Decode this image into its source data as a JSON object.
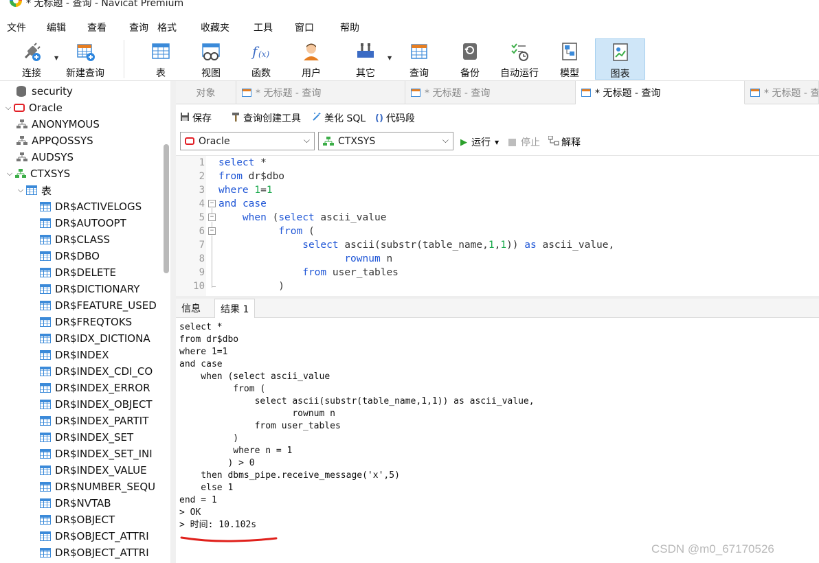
{
  "window": {
    "title": "* 无标题 - 查询 - Navicat Premium"
  },
  "menu": [
    "文件",
    "编辑",
    "查看",
    "查询",
    "格式",
    "收藏夹",
    "工具",
    "窗口",
    "帮助"
  ],
  "toolbar": {
    "connect": "连接",
    "new_query": "新建查询",
    "table": "表",
    "view": "视图",
    "function": "函数",
    "user": "用户",
    "other": "其它",
    "query": "查询",
    "backup": "备份",
    "automation": "自动运行",
    "model": "模型",
    "chart": "图表"
  },
  "sidebar": {
    "items": [
      {
        "label": "security",
        "type": "db"
      },
      {
        "label": "Oracle",
        "type": "oracle"
      },
      {
        "label": "ANONYMOUS",
        "type": "schema"
      },
      {
        "label": "APPQOSSYS",
        "type": "schema"
      },
      {
        "label": "AUDSYS",
        "type": "schema"
      },
      {
        "label": "CTXSYS",
        "type": "schema-active"
      },
      {
        "label": "表",
        "type": "tables"
      },
      {
        "label": "DR$ACTIVELOGS",
        "type": "table"
      },
      {
        "label": "DR$AUTOOPT",
        "type": "table"
      },
      {
        "label": "DR$CLASS",
        "type": "table"
      },
      {
        "label": "DR$DBO",
        "type": "table"
      },
      {
        "label": "DR$DELETE",
        "type": "table"
      },
      {
        "label": "DR$DICTIONARY",
        "type": "table"
      },
      {
        "label": "DR$FEATURE_USED",
        "type": "table"
      },
      {
        "label": "DR$FREQTOKS",
        "type": "table"
      },
      {
        "label": "DR$IDX_DICTIONA",
        "type": "table"
      },
      {
        "label": "DR$INDEX",
        "type": "table"
      },
      {
        "label": "DR$INDEX_CDI_CO",
        "type": "table"
      },
      {
        "label": "DR$INDEX_ERROR",
        "type": "table"
      },
      {
        "label": "DR$INDEX_OBJECT",
        "type": "table"
      },
      {
        "label": "DR$INDEX_PARTIT",
        "type": "table"
      },
      {
        "label": "DR$INDEX_SET",
        "type": "table"
      },
      {
        "label": "DR$INDEX_SET_INI",
        "type": "table"
      },
      {
        "label": "DR$INDEX_VALUE",
        "type": "table"
      },
      {
        "label": "DR$NUMBER_SEQU",
        "type": "table"
      },
      {
        "label": "DR$NVTAB",
        "type": "table"
      },
      {
        "label": "DR$OBJECT",
        "type": "table"
      },
      {
        "label": "DR$OBJECT_ATTRI",
        "type": "table"
      },
      {
        "label": "DR$OBJECT_ATTRI",
        "type": "table"
      }
    ]
  },
  "tabs": [
    {
      "label": "对象",
      "active": false
    },
    {
      "label": "* 无标题 - 查询",
      "active": false
    },
    {
      "label": "* 无标题 - 查询",
      "active": false
    },
    {
      "label": "* 无标题 - 查询",
      "active": true
    },
    {
      "label": "* 无标题 - 查询",
      "active": false
    }
  ],
  "query_toolbar": {
    "save": "保存",
    "builder": "查询创建工具",
    "beautify": "美化 SQL",
    "snippet": "代码段"
  },
  "connection_select": "Oracle",
  "schema_select": "CTXSYS",
  "run": {
    "run": "运行",
    "stop": "停止",
    "explain": "解释"
  },
  "editor": {
    "line_numbers": [
      "1",
      "2",
      "3",
      "4",
      "5",
      "6",
      "7",
      "8",
      "9",
      "10"
    ]
  },
  "result_tabs": [
    "信息",
    "结果 1"
  ],
  "output": [
    "select *",
    "from dr$dbo",
    "where 1=1",
    "and case",
    "    when (select ascii_value",
    "          from (",
    "              select ascii(substr(table_name,1,1)) as ascii_value,",
    "                     rownum n",
    "              from user_tables",
    "          )",
    "          where n = 1",
    "         ) > 0",
    "    then dbms_pipe.receive_message('x',5)",
    "    else 1",
    "end = 1",
    "> OK",
    "> 时间: 10.102s"
  ],
  "watermark": "CSDN @m0_67170526",
  "colors": {
    "keyword": "#1f56d6",
    "number": "#18a84a",
    "annotation": "#e0201b",
    "active_tool": "#cfe6f8"
  }
}
